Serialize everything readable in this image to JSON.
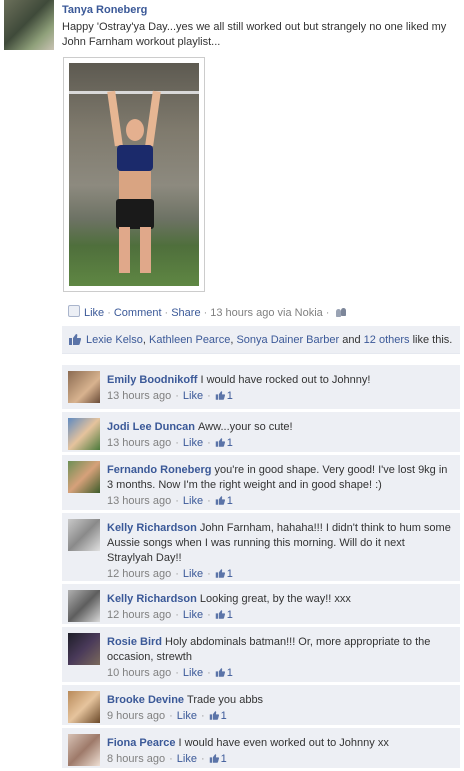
{
  "post": {
    "author": "Tanya Roneberg",
    "text": "Happy 'Ostray'ya Day...yes we all still worked out but strangely no one liked my John Farnham workout playlist...",
    "actions": {
      "like": "Like",
      "comment": "Comment",
      "share": "Share",
      "timestamp": "13 hours ago via Nokia",
      "separator": "·"
    }
  },
  "likes": {
    "names": [
      "Lexie Kelso",
      "Kathleen Pearce",
      "Sonya Dainer Barber"
    ],
    "sep1": ", ",
    "sep2": ", ",
    "and": " and ",
    "others": "12 others",
    "suffix": " like this."
  },
  "comments": [
    {
      "author": "Emily Boodnikoff",
      "text": "I would have rocked out to Johnny!",
      "time": "13 hours ago",
      "like": "Like",
      "count": "1"
    },
    {
      "author": "Jodi Lee Duncan",
      "text": "Aww...your so cute!",
      "time": "13 hours ago",
      "like": "Like",
      "count": "1"
    },
    {
      "author": "Fernando Roneberg",
      "text": "you're in good shape. Very good! I've lost 9kg in 3 months. Now I'm the right weight and in good shape! :)",
      "time": "13 hours ago",
      "like": "Like",
      "count": "1"
    },
    {
      "author": "Kelly Richardson",
      "text": "John Farnham, hahaha!!! I didn't think to hum some Aussie songs when I was running this morning. Will do it next Straylyah Day!!",
      "time": "12 hours ago",
      "like": "Like",
      "count": "1"
    },
    {
      "author": "Kelly Richardson",
      "text": "Looking great, by the way!! xxx",
      "time": "12 hours ago",
      "like": "Like",
      "count": "1"
    },
    {
      "author": "Rosie Bird",
      "text": "Holy abdominals batman!!! Or, more appropriate to the occasion, strewth",
      "time": "10 hours ago",
      "like": "Like",
      "count": "1"
    },
    {
      "author": "Brooke Devine",
      "text": "Trade you abbs",
      "time": "9 hours ago",
      "like": "Like",
      "count": "1"
    },
    {
      "author": "Fiona Pearce",
      "text": "I would have even worked out to Johnny xx",
      "time": "8 hours ago",
      "like": "Like",
      "count": "1"
    }
  ],
  "colors": {
    "link": "#3b5998",
    "meta": "#808080",
    "box": "#edeff4"
  },
  "icons": {
    "like": "thumbs-up-icon",
    "audience": "friends-icon"
  }
}
